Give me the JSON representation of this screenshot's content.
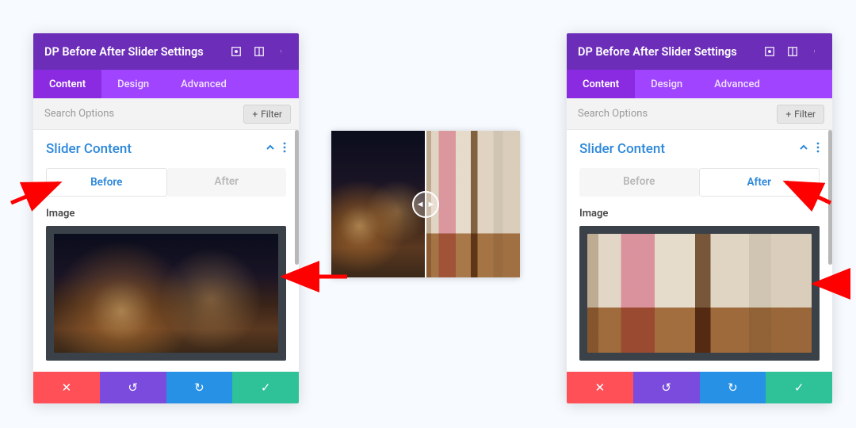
{
  "header": {
    "title": "DP Before After Slider Settings"
  },
  "tabs": {
    "content": "Content",
    "design": "Design",
    "advanced": "Advanced"
  },
  "search": {
    "placeholder": "Search Options",
    "filter_label": "Filter"
  },
  "section": {
    "title": "Slider Content"
  },
  "subtabs": {
    "before": "Before",
    "after": "After"
  },
  "fields": {
    "image": "Image"
  },
  "footer": {
    "cancel": "✕",
    "undo": "↺",
    "redo": "↻",
    "save": "✓"
  }
}
